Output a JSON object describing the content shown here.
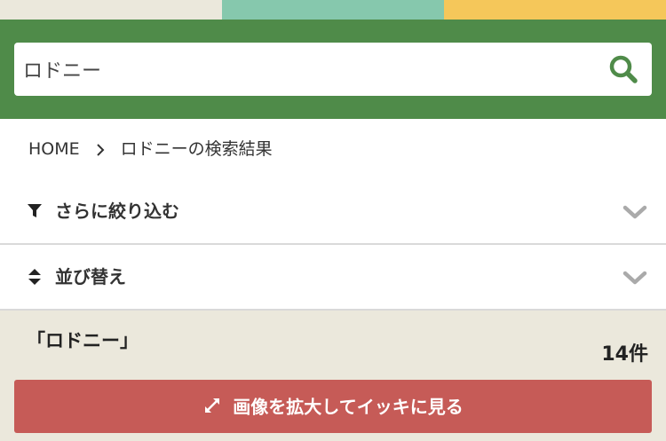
{
  "colors": {
    "header_bg": "#4f8b49",
    "strip_beige": "#ebe8dc",
    "strip_teal": "#86c8ad",
    "strip_yellow": "#f5c75a",
    "search_icon": "#4f8b49",
    "results_bg": "#ebe8dc",
    "enlarge_button_bg": "#c65b57"
  },
  "search": {
    "value": "ロドニー",
    "icon": "search-icon"
  },
  "breadcrumb": {
    "home": "HOME",
    "current": "ロドニーの検索結果"
  },
  "filters": {
    "narrow": {
      "label": "さらに絞り込む",
      "icon": "filter-icon",
      "chevron": "chevron-down-icon"
    },
    "sort": {
      "label": "並び替え",
      "icon": "sort-icon",
      "chevron": "chevron-down-icon"
    }
  },
  "results": {
    "query_title": "「ロドニー」",
    "count": "14件",
    "enlarge_button": {
      "label": "画像を拡大してイッキに見る",
      "icon": "expand-icon"
    }
  }
}
